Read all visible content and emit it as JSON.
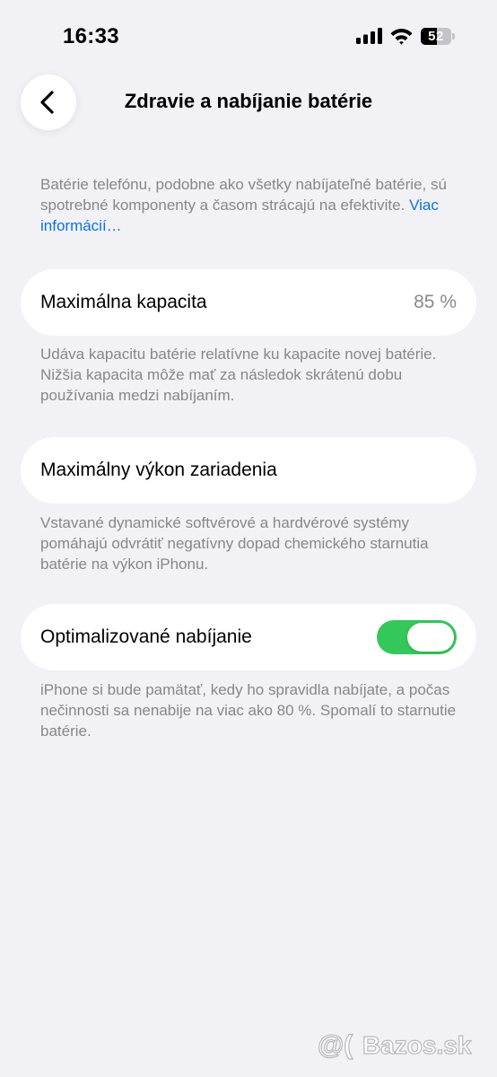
{
  "status_bar": {
    "time": "16:33",
    "battery_level": "52",
    "battery_fraction": 0.52,
    "icons": [
      "signal-icon",
      "wifi-icon",
      "battery-icon"
    ]
  },
  "header": {
    "back_icon": "chevron-left-icon",
    "title": "Zdravie a nabíjanie batérie"
  },
  "intro": {
    "text": "Batérie telefónu, podobne ako všetky nabíjateľné batérie, sú spotrebné komponenty a časom strácajú na efektivite. ",
    "link": "Viac informácií…"
  },
  "max_capacity": {
    "label": "Maximálna kapacita",
    "value": "85 %",
    "description": "Udáva kapacitu batérie relatívne ku kapacite novej batérie. Nižšia kapacita môže mať za následok skrátenú dobu používania medzi nabíjaním."
  },
  "peak_performance": {
    "label": "Maximálny výkon zariadenia",
    "description": "Vstavané dynamické softvérové a hardvérové systémy pomáhajú odvrátiť negatívny dopad chemického starnutia batérie na výkon iPhonu."
  },
  "optimized_charging": {
    "label": "Optimalizované nabíjanie",
    "enabled": true,
    "description": "iPhone si bude pamätať, kedy ho spravidla nabíjate, a počas nečinnosti sa nenabije na viac ako 80 %. Spomalí to starnutie batérie."
  },
  "watermark": {
    "text": "Bazos.sk"
  },
  "colors": {
    "background": "#f1f1f6",
    "card": "#ffffff",
    "toggle_on": "#34c759",
    "link": "#0a74e0",
    "secondary_text": "#86868b"
  }
}
